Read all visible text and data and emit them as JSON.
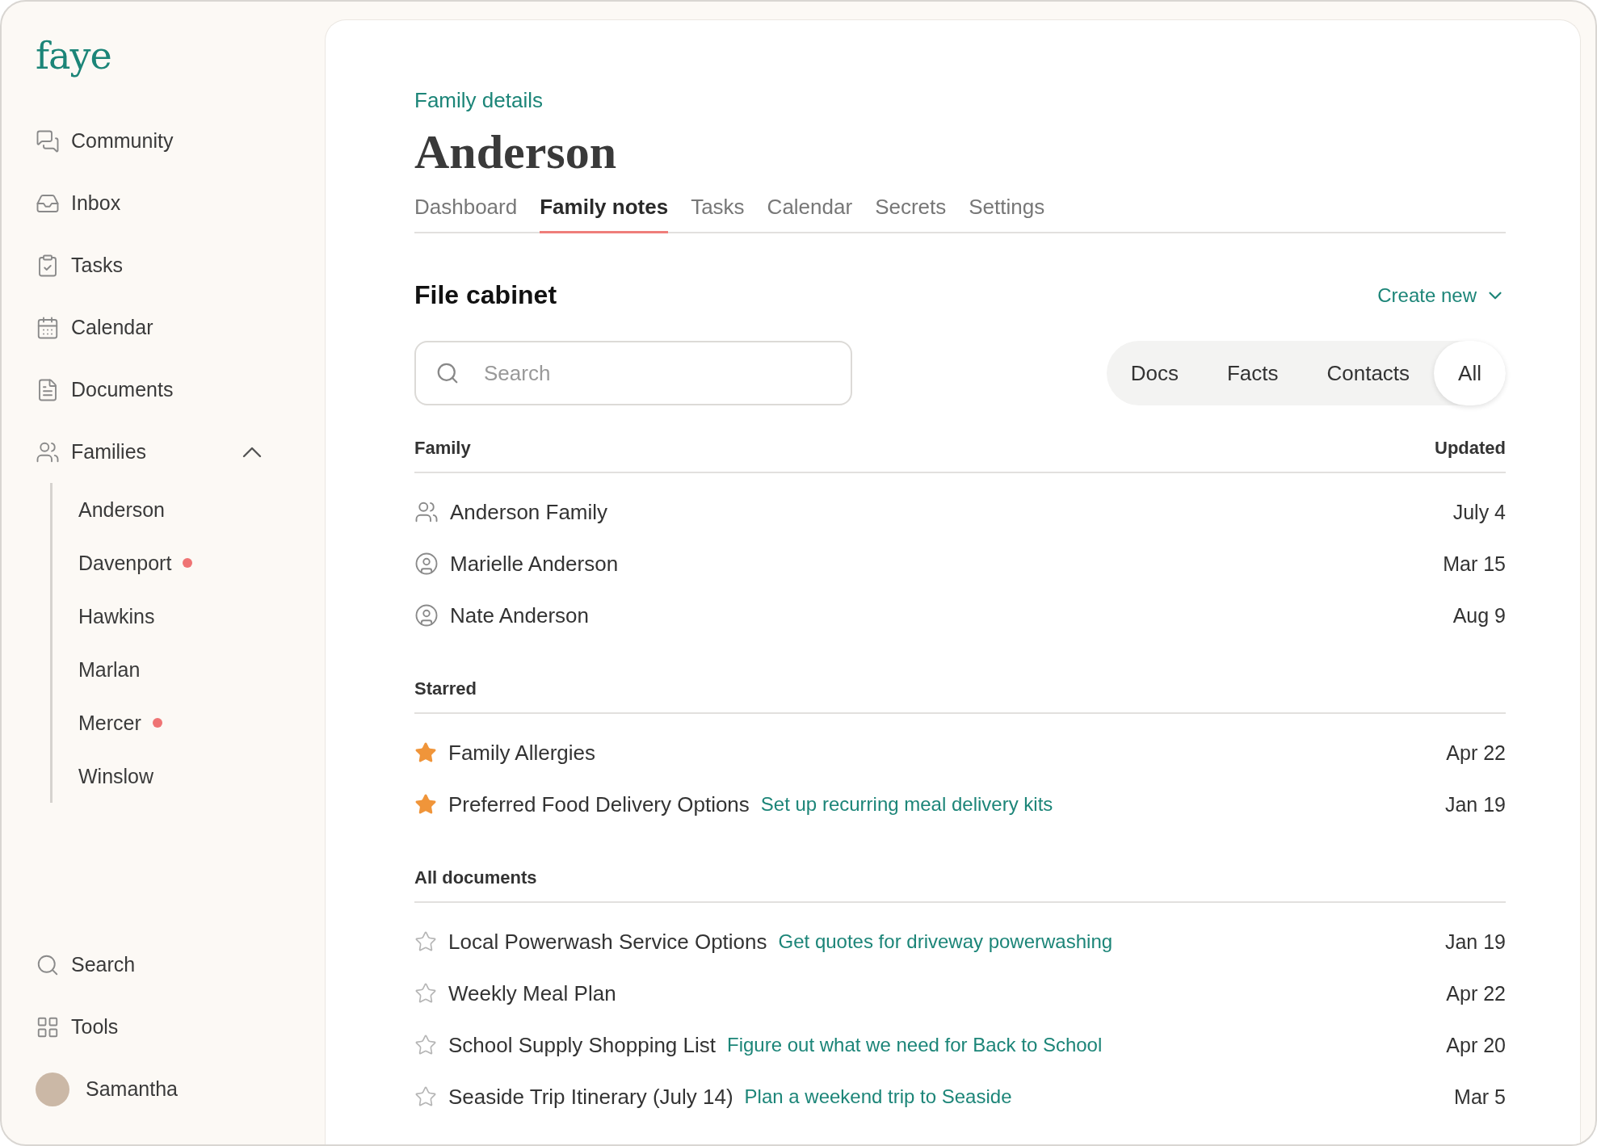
{
  "sidebar": {
    "logo": "faye",
    "nav": [
      {
        "label": "Community"
      },
      {
        "label": "Inbox"
      },
      {
        "label": "Tasks"
      },
      {
        "label": "Calendar"
      },
      {
        "label": "Documents"
      },
      {
        "label": "Families",
        "expanded": true,
        "children": [
          {
            "label": "Anderson",
            "unread": false
          },
          {
            "label": "Davenport",
            "unread": true
          },
          {
            "label": "Hawkins",
            "unread": false
          },
          {
            "label": "Marlan",
            "unread": false
          },
          {
            "label": "Mercer",
            "unread": true
          },
          {
            "label": "Winslow",
            "unread": false
          }
        ]
      }
    ],
    "bottom": [
      {
        "label": "Search"
      },
      {
        "label": "Tools"
      }
    ],
    "user": {
      "name": "Samantha"
    }
  },
  "breadcrumb": "Family details",
  "title": "Anderson",
  "tabs": [
    {
      "label": "Dashboard",
      "selected": false
    },
    {
      "label": "Family notes",
      "selected": true
    },
    {
      "label": "Tasks",
      "selected": false
    },
    {
      "label": "Calendar",
      "selected": false
    },
    {
      "label": "Secrets",
      "selected": false
    },
    {
      "label": "Settings",
      "selected": false
    }
  ],
  "cabinet": {
    "title": "File cabinet",
    "create_button": "Create new",
    "search": {
      "placeholder": "Search"
    },
    "filters": [
      {
        "label": "Docs",
        "selected": false
      },
      {
        "label": "Facts",
        "selected": false
      },
      {
        "label": "Contacts",
        "selected": false
      },
      {
        "label": "All",
        "selected": true
      }
    ],
    "sections": [
      {
        "title": "Family",
        "updated_header": "Updated",
        "rows": [
          {
            "kind": "family",
            "name": "Anderson Family",
            "updated": "July 4"
          },
          {
            "kind": "person",
            "name": "Marielle Anderson",
            "updated": "Mar 15"
          },
          {
            "kind": "person",
            "name": "Nate Anderson",
            "updated": "Aug 9"
          }
        ]
      },
      {
        "title": "Starred",
        "rows": [
          {
            "kind": "doc",
            "starred": true,
            "name": "Family Allergies",
            "updated": "Apr 22"
          },
          {
            "kind": "doc",
            "starred": true,
            "name": "Preferred Food Delivery Options",
            "task": "Set up recurring meal delivery kits",
            "updated": "Jan 19"
          }
        ]
      },
      {
        "title": "All documents",
        "rows": [
          {
            "kind": "doc",
            "starred": false,
            "name": "Local Powerwash Service Options",
            "task": "Get quotes for driveway powerwashing",
            "updated": "Jan 19"
          },
          {
            "kind": "doc",
            "starred": false,
            "name": "Weekly Meal Plan",
            "updated": "Apr 22"
          },
          {
            "kind": "doc",
            "starred": false,
            "name": "School Supply Shopping List",
            "task": "Figure out what we need for Back to School",
            "updated": "Apr 20"
          },
          {
            "kind": "doc",
            "starred": false,
            "name": "Seaside Trip Itinerary (July 14)",
            "task": "Plan a weekend trip to Seaside",
            "updated": "Mar 5"
          }
        ]
      }
    ]
  }
}
